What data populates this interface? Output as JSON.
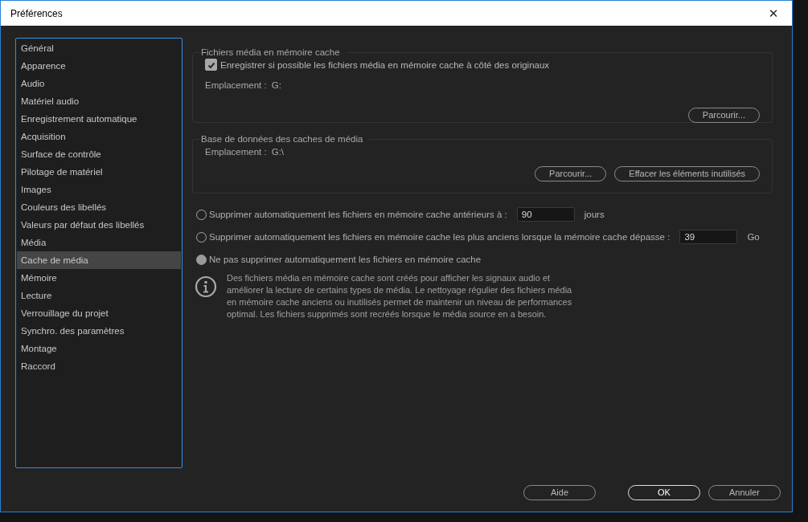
{
  "window": {
    "title": "Préférences",
    "close": "✕"
  },
  "sidebar": {
    "items": [
      {
        "label": "Général",
        "selected": false
      },
      {
        "label": "Apparence",
        "selected": false
      },
      {
        "label": "Audio",
        "selected": false
      },
      {
        "label": "Matériel audio",
        "selected": false
      },
      {
        "label": "Enregistrement automatique",
        "selected": false
      },
      {
        "label": "Acquisition",
        "selected": false
      },
      {
        "label": "Surface de contrôle",
        "selected": false
      },
      {
        "label": "Pilotage de matériel",
        "selected": false
      },
      {
        "label": "Images",
        "selected": false
      },
      {
        "label": "Couleurs des libellés",
        "selected": false
      },
      {
        "label": "Valeurs par défaut des libellés",
        "selected": false
      },
      {
        "label": "Média",
        "selected": false
      },
      {
        "label": "Cache de média",
        "selected": true
      },
      {
        "label": "Mémoire",
        "selected": false
      },
      {
        "label": "Lecture",
        "selected": false
      },
      {
        "label": "Verrouillage du projet",
        "selected": false
      },
      {
        "label": "Synchro. des paramètres",
        "selected": false
      },
      {
        "label": "Montage",
        "selected": false
      },
      {
        "label": "Raccord",
        "selected": false
      }
    ]
  },
  "media_cache_files": {
    "title": "Fichiers média en mémoire cache",
    "checkbox": {
      "label": "Enregistrer si possible les fichiers média en mémoire cache à côté des originaux",
      "checked": true
    },
    "location_label": "Emplacement :",
    "location_value": "G:",
    "buttons": [
      "Parcourir..."
    ]
  },
  "media_cache_database": {
    "title": "Base de données des caches de média",
    "location_label": "Emplacement :",
    "location_value": "G:\\",
    "buttons": [
      "Parcourir...",
      "Effacer les éléments inutilisés"
    ]
  },
  "cleanup_options": [
    {
      "label": "Supprimer automatiquement les fichiers en mémoire cache antérieurs à :",
      "selected": false,
      "value": "90",
      "unit": "jours"
    },
    {
      "label": "Supprimer automatiquement les fichiers en mémoire cache les plus anciens lorsque la mémoire cache dépasse :",
      "selected": false,
      "value": "39",
      "unit": "Go"
    },
    {
      "label": "Ne pas supprimer automatiquement les fichiers en mémoire cache",
      "selected": true
    }
  ],
  "info_text": "Des fichiers média en mémoire cache sont créés pour afficher les signaux audio et améliorer la lecture de certains types de média. Le nettoyage régulier des fichiers média en mémoire cache anciens ou inutilisés permet de maintenir un niveau de performances optimal. Les fichiers supprimés sont recréés lorsque le média source en a besoin.",
  "footer_buttons": [
    {
      "label": "Aide",
      "default": false
    },
    {
      "label": "OK",
      "default": true
    },
    {
      "label": "Annuler",
      "default": false
    }
  ]
}
